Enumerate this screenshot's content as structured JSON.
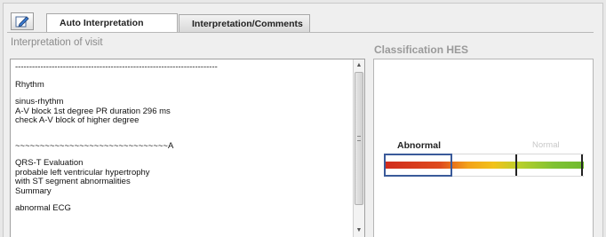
{
  "tabs": [
    {
      "label": "Auto Interpretation",
      "active": true
    },
    {
      "label": "Interpretation/Comments",
      "active": false
    }
  ],
  "toolbar": {
    "edit_icon": "edit-icon"
  },
  "interpretation": {
    "title": "Interpretation of visit",
    "lines": [
      "------------------------------------------------------------------------",
      "",
      "Rhythm",
      "",
      "sinus-rhythm",
      "A-V block 1st degree   PR duration  296 ms",
      "check A-V block of higher degree",
      "",
      "",
      "  ~~~~~~~~~~~~~~~~~~~~~~~~~~~~~~~A",
      "",
      "QRS-T  Evaluation",
      "probable left ventricular hypertrophy",
      "with ST segment abnormalities",
      "Summary",
      "",
      "abnormal ECG"
    ]
  },
  "classification": {
    "title": "Classification HES",
    "left_label": "Abnormal",
    "right_label": "Normal",
    "selected_segment": "Abnormal",
    "gradient_colors": [
      "#d02b1e",
      "#f3a21a",
      "#6fbb2e"
    ]
  }
}
